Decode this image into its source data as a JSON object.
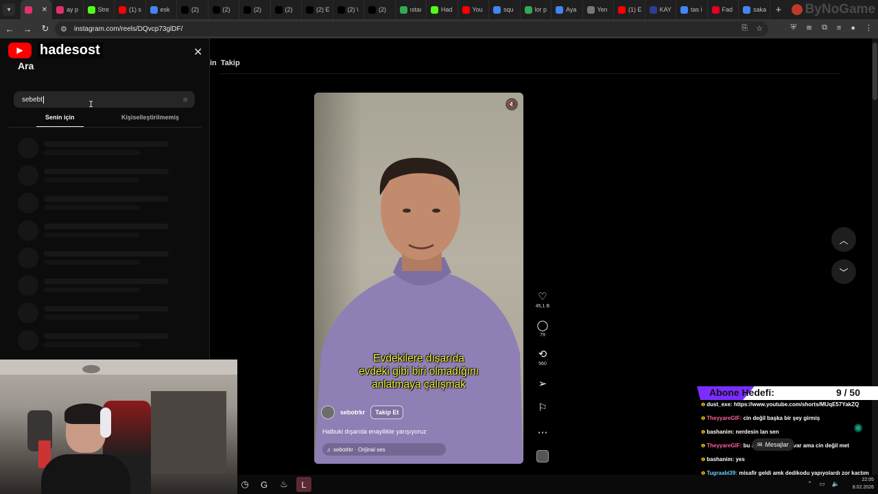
{
  "browser": {
    "tabs": [
      {
        "label": "ay p",
        "icon": "#e1306c"
      },
      {
        "label": "Stre",
        "icon": "#53fc18"
      },
      {
        "label": "(1) s",
        "icon": "#ff0000"
      },
      {
        "label": "esk",
        "icon": "#4285f4"
      },
      {
        "label": "(2)",
        "icon": "#000000"
      },
      {
        "label": "(2)",
        "icon": "#000000"
      },
      {
        "label": "(2)",
        "icon": "#000000"
      },
      {
        "label": "(2)",
        "icon": "#000000"
      },
      {
        "label": "(2) E",
        "icon": "#000000"
      },
      {
        "label": "(2) \\",
        "icon": "#000000"
      },
      {
        "label": "(2)",
        "icon": "#000000"
      },
      {
        "label": "ıstaı",
        "icon": "#34a853"
      },
      {
        "label": "Had",
        "icon": "#53fc18"
      },
      {
        "label": "You",
        "icon": "#ff0000"
      },
      {
        "label": "squ",
        "icon": "#4285f4"
      },
      {
        "label": "lor p",
        "icon": "#34a853"
      },
      {
        "label": "Aya",
        "icon": "#4285f4"
      },
      {
        "label": "Yen",
        "icon": "#777777"
      },
      {
        "label": "(1) E",
        "icon": "#ff0000"
      },
      {
        "label": "KAY",
        "icon": "#2c3e91"
      },
      {
        "label": "tas i",
        "icon": "#4285f4"
      },
      {
        "label": "Fad",
        "icon": "#e60023"
      },
      {
        "label": "saka",
        "icon": "#4285f4"
      }
    ],
    "watermark": "ByNoGame",
    "url": "instagram.com/reels/DQvcp73glDF/"
  },
  "search_panel": {
    "title": "Ara",
    "query": "sebebt",
    "tabs": [
      "Senin için",
      "Kişiselleştirilmemiş"
    ]
  },
  "feed_tabs": [
    "in",
    "Takip"
  ],
  "reel": {
    "subtitle_lines": [
      "Evdekilere dışarıda",
      "evdeki gibi biri olmadığını",
      "anlatmaya çalışmak"
    ],
    "username": "sebotrkr",
    "follow_label": "Takip Et",
    "caption": "Halbuki dışarıda enayilikte yarışıyoruz",
    "audio": "sebotrkr · Orijinal ses",
    "likes": "45,1 B",
    "comments": "79",
    "reposts": "560"
  },
  "stream": {
    "channel": "hadesost",
    "sub_goal_label": "Abone Hedefi:",
    "sub_goal_count": "9 / 50",
    "sub_goal_current": 9,
    "sub_goal_target": 50,
    "chat": [
      {
        "user": "dust_exe:",
        "text": "https://www.youtube.com/shorts/MUqE57YakZQ",
        "style": "plain"
      },
      {
        "user": "TheyyareGIF:",
        "text": "cin değil başka bir şey girmiş",
        "style": "pink"
      },
      {
        "user": "bashanim:",
        "text": "nerdesin lan sen",
        "style": "plain"
      },
      {
        "user": "TheyyareGIF:",
        "text": "bu adamda 3 harfli var ama cin değil met",
        "style": "pink"
      },
      {
        "user": "bashanim:",
        "text": "yes",
        "style": "plain"
      },
      {
        "user": "Tugraabi39:",
        "text": "misafir geldi amk dedikodu yapıyolardı zor kactım",
        "style": "cyan"
      }
    ],
    "messages_popup": "Mesajlar",
    "time": "22:05",
    "date": "8.02.2026"
  }
}
